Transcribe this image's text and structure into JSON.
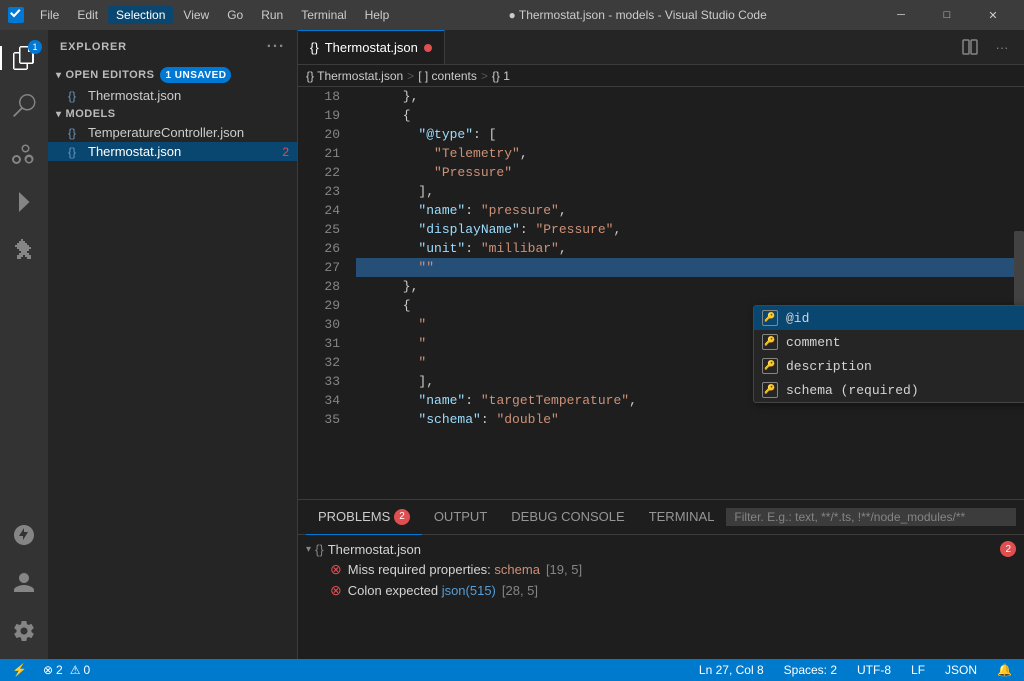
{
  "titlebar": {
    "vscode_icon": "VS",
    "menu": [
      "File",
      "Edit",
      "Selection",
      "View",
      "Go",
      "Run",
      "Terminal",
      "Help"
    ],
    "active_menu": "Selection",
    "title": "● Thermostat.json - models - Visual Studio Code",
    "controls": [
      "─",
      "□",
      "✕"
    ]
  },
  "activity_bar": {
    "items": [
      {
        "name": "explorer",
        "icon": "files",
        "active": true,
        "badge": "1"
      },
      {
        "name": "search",
        "icon": "search",
        "active": false
      },
      {
        "name": "source-control",
        "icon": "git",
        "active": false
      },
      {
        "name": "run",
        "icon": "run",
        "active": false
      },
      {
        "name": "extensions",
        "icon": "extensions",
        "active": false
      },
      {
        "name": "remote-explorer",
        "icon": "remote",
        "active": false,
        "bottom": true
      },
      {
        "name": "accounts",
        "icon": "account",
        "active": false,
        "bottom": true
      },
      {
        "name": "settings",
        "icon": "gear",
        "active": false,
        "bottom": true
      }
    ]
  },
  "sidebar": {
    "title": "EXPLORER",
    "open_editors": {
      "label": "OPEN EDITORS",
      "badge": "1 UNSAVED",
      "files": [
        {
          "name": "Thermostat.json",
          "icon": "{}",
          "errors": 0,
          "active": false
        }
      ]
    },
    "models": {
      "label": "MODELS",
      "files": [
        {
          "name": "TemperatureController.json",
          "icon": "{}",
          "errors": 0,
          "active": false
        },
        {
          "name": "Thermostat.json",
          "icon": "{}",
          "errors": 2,
          "active": true
        }
      ]
    }
  },
  "editor": {
    "tab": {
      "name": "Thermostat.json",
      "modified": true,
      "icon": "{}"
    },
    "breadcrumb": [
      {
        "label": "{} Thermostat.json"
      },
      {
        "label": "[ ] contents"
      },
      {
        "label": "{} 1"
      }
    ],
    "lines": [
      {
        "num": 18,
        "content": "      },",
        "class": ""
      },
      {
        "num": 19,
        "content": "      {",
        "class": ""
      },
      {
        "num": 20,
        "content": "        \"@type\": [",
        "class": ""
      },
      {
        "num": 21,
        "content": "          \"Telemetry\",",
        "class": ""
      },
      {
        "num": 22,
        "content": "          \"Pressure\"",
        "class": ""
      },
      {
        "num": 23,
        "content": "        ],",
        "class": ""
      },
      {
        "num": 24,
        "content": "        \"name\": \"pressure\",",
        "class": ""
      },
      {
        "num": 25,
        "content": "        \"displayName\": \"Pressure\",",
        "class": ""
      },
      {
        "num": 26,
        "content": "        \"unit\": \"millibar\",",
        "class": ""
      },
      {
        "num": 27,
        "content": "        \"\"",
        "class": "highlighted"
      },
      {
        "num": 28,
        "content": "      },",
        "class": ""
      },
      {
        "num": 29,
        "content": "      {",
        "class": ""
      },
      {
        "num": 30,
        "content": "        \"",
        "class": ""
      },
      {
        "num": 31,
        "content": "        \"",
        "class": ""
      },
      {
        "num": 32,
        "content": "        \"",
        "class": ""
      },
      {
        "num": 33,
        "content": "        ],",
        "class": ""
      },
      {
        "num": 34,
        "content": "        \"name\": \"targetTemperature\",",
        "class": ""
      },
      {
        "num": 35,
        "content": "        \"schema\": \"double\"",
        "class": ""
      }
    ],
    "autocomplete": {
      "items": [
        {
          "label": "@id",
          "selected": true
        },
        {
          "label": "comment",
          "selected": false
        },
        {
          "label": "description",
          "selected": false
        },
        {
          "label": "schema (required)",
          "selected": false
        }
      ]
    }
  },
  "panel": {
    "tabs": [
      {
        "label": "PROBLEMS",
        "badge": "2",
        "active": true
      },
      {
        "label": "OUTPUT",
        "active": false
      },
      {
        "label": "DEBUG CONSOLE",
        "active": false
      },
      {
        "label": "TERMINAL",
        "active": false
      }
    ],
    "filter_placeholder": "Filter. E.g.: text, **/*.ts, !**/node_modules/**",
    "sections": [
      {
        "filename": "Thermostat.json",
        "icon": "{}",
        "error_count": "2",
        "errors": [
          {
            "text": "Miss required properties: schema",
            "location": "[19, 5]"
          },
          {
            "text": "Colon expected json(515)",
            "location": "[28, 5]"
          }
        ]
      }
    ]
  },
  "status_bar": {
    "left": {
      "git_icon": "⎇",
      "errors": "2",
      "warnings": "0"
    },
    "right": {
      "position": "Ln 27, Col 8",
      "spaces": "Spaces: 2",
      "encoding": "UTF-8",
      "eol": "LF",
      "language": "JSON",
      "notifications_icon": "🔔",
      "remote_icon": "⚡"
    }
  }
}
